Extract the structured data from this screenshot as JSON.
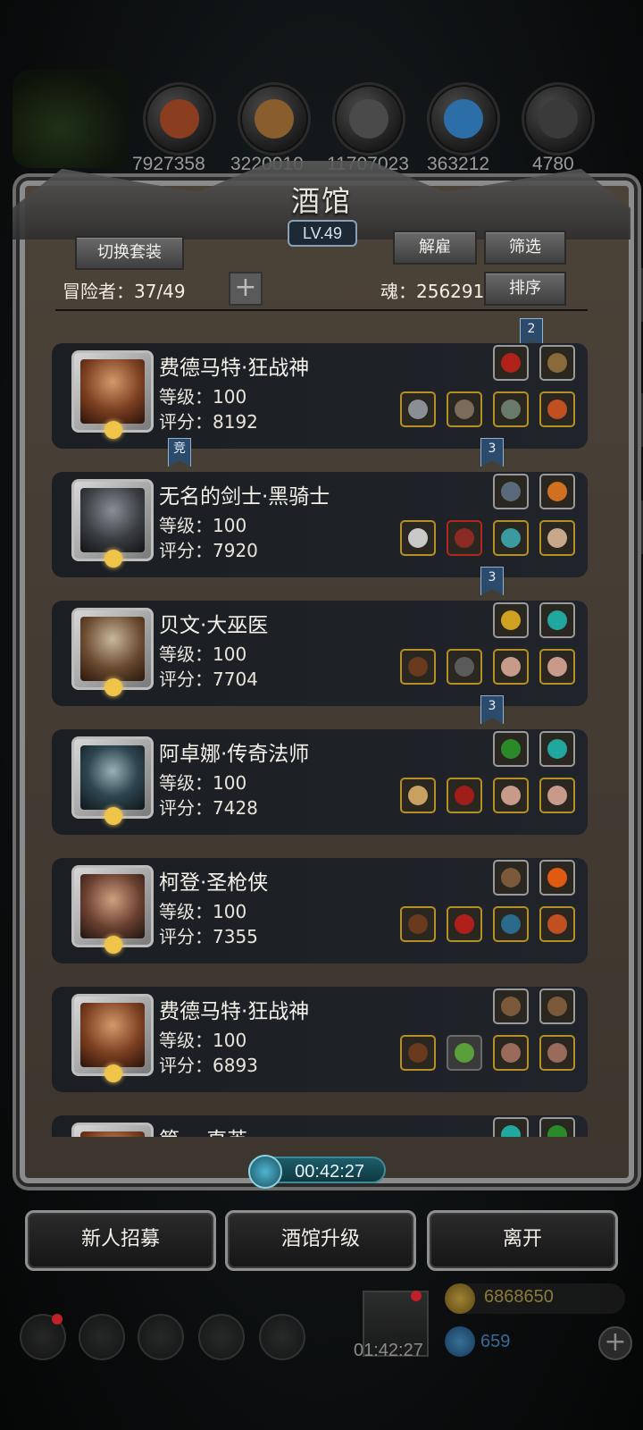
{
  "resources": [
    {
      "icon": "meat-icon",
      "value": "7927358",
      "color": "#8a3d1f"
    },
    {
      "icon": "wood-icon",
      "value": "3220010",
      "color": "#8a5e2c"
    },
    {
      "icon": "stone-icon",
      "value": "11707023",
      "color": "#4a4a4a"
    },
    {
      "icon": "crystal-icon",
      "value": "363212",
      "color": "#2b6ea8"
    },
    {
      "icon": "iron-icon",
      "value": "4780",
      "color": "#3a3a3a"
    }
  ],
  "panel": {
    "title": "酒馆",
    "level": "LV.49",
    "switch_outfit_label": "切换套装",
    "dismiss_label": "解雇",
    "filter_label": "筛选",
    "sort_label": "排序",
    "adventurers_label": "冒险者：37/49",
    "soul_label": "魂：256291",
    "plus_label": "+"
  },
  "heroes": [
    {
      "name": "费德马特·狂战神",
      "level": "等级：100",
      "score": "评分：8192",
      "face_color": "#b9764a",
      "ribbon_above": "2",
      "tag_below": "竞",
      "ribbon_below": "3"
    },
    {
      "name": "无名的剑士·黑骑士",
      "level": "等级：100",
      "score": "评分：7920",
      "face_color": "#5a5e63",
      "ribbon_below": "3"
    },
    {
      "name": "贝文·大巫医",
      "level": "等级：100",
      "score": "评分：7704",
      "face_color": "#9a7b5b",
      "ribbon_below": "3"
    },
    {
      "name": "阿卓娜·传奇法师",
      "level": "等级：100",
      "score": "评分：7428",
      "face_color": "#3b5560"
    },
    {
      "name": "柯登·圣枪侠",
      "level": "等级：100",
      "score": "评分：7355",
      "face_color": "#a36c4a"
    },
    {
      "name": "费德马特·狂战神",
      "level": "等级：100",
      "score": "评分：6893",
      "face_color": "#b9764a"
    },
    {
      "name": "第一 直英",
      "level": "",
      "score": "",
      "face_color": "#b9764a"
    }
  ],
  "timer": "00:42:27",
  "buttons": {
    "recruit": "新人招募",
    "upgrade": "酒馆升级",
    "leave": "离开"
  },
  "bottom": {
    "gift_timer": "01:42:27",
    "gold": "6868650",
    "gems": "659",
    "plus": "+"
  }
}
